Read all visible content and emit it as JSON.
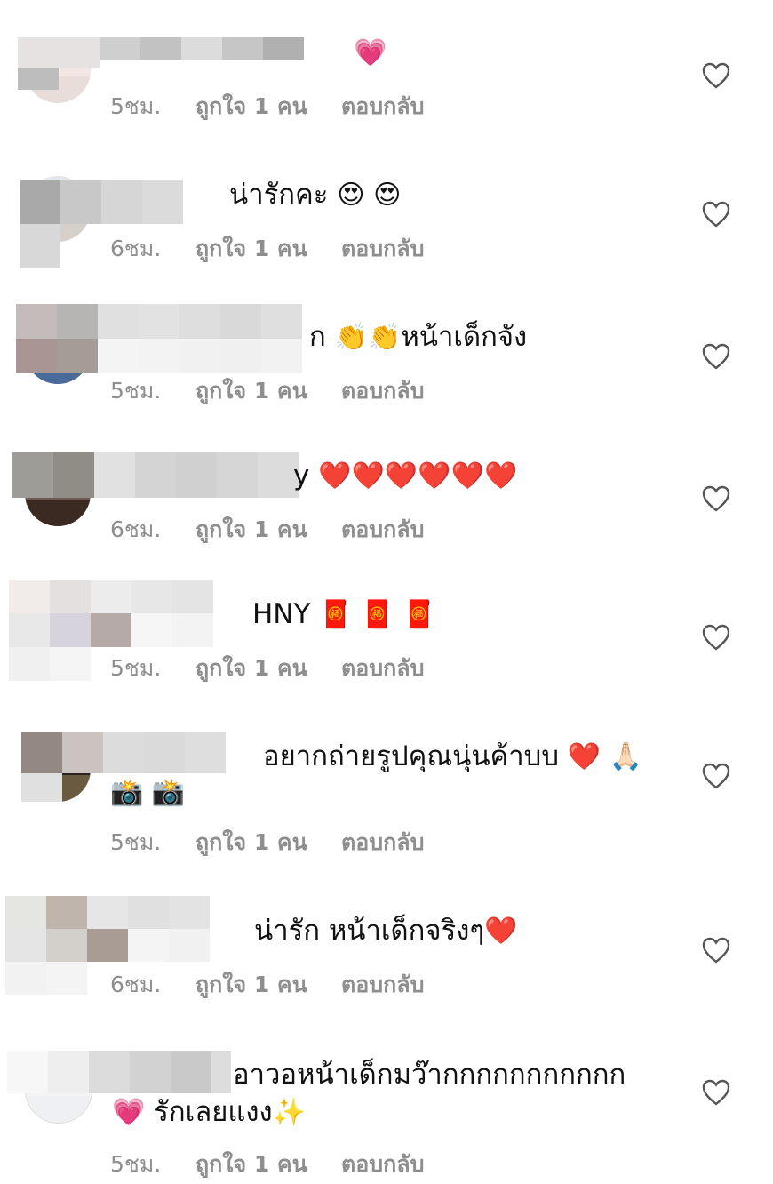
{
  "like_label": "ถูกใจ 1 คน",
  "reply_label": "ตอบกลับ",
  "comments": [
    {
      "text": "",
      "emoji": "💗",
      "time": "5ชม."
    },
    {
      "text": "น่ารักคะ",
      "emoji": "😍 😍",
      "time": "6ชม."
    },
    {
      "text": "ก",
      "emoji": "👏👏",
      "text2": "หน้าเด็กจัง",
      "time": "5ชม."
    },
    {
      "text": "y",
      "emoji": "❤️❤️❤️❤️❤️❤️",
      "time": "6ชม."
    },
    {
      "text": "HNY",
      "emoji": "🧧 🧧 🧧",
      "time": "5ชม."
    },
    {
      "text": "อยากถ่ายรูปคุณนุ่นค้าบบ",
      "emoji": "❤️ 🙏🏻",
      "line2": "📸 📸",
      "time": "5ชม."
    },
    {
      "text": "น่ารัก หน้าเด็กจริงๆ",
      "emoji": "❤️",
      "time": "6ชม."
    },
    {
      "text": "อาวอหน้าเด็กมว๊ากกกกกกกกกกก",
      "line2_emoji": "💗",
      "line2": "รักเลยแงง",
      "line2_end": "✨",
      "time": "5ชม."
    }
  ]
}
